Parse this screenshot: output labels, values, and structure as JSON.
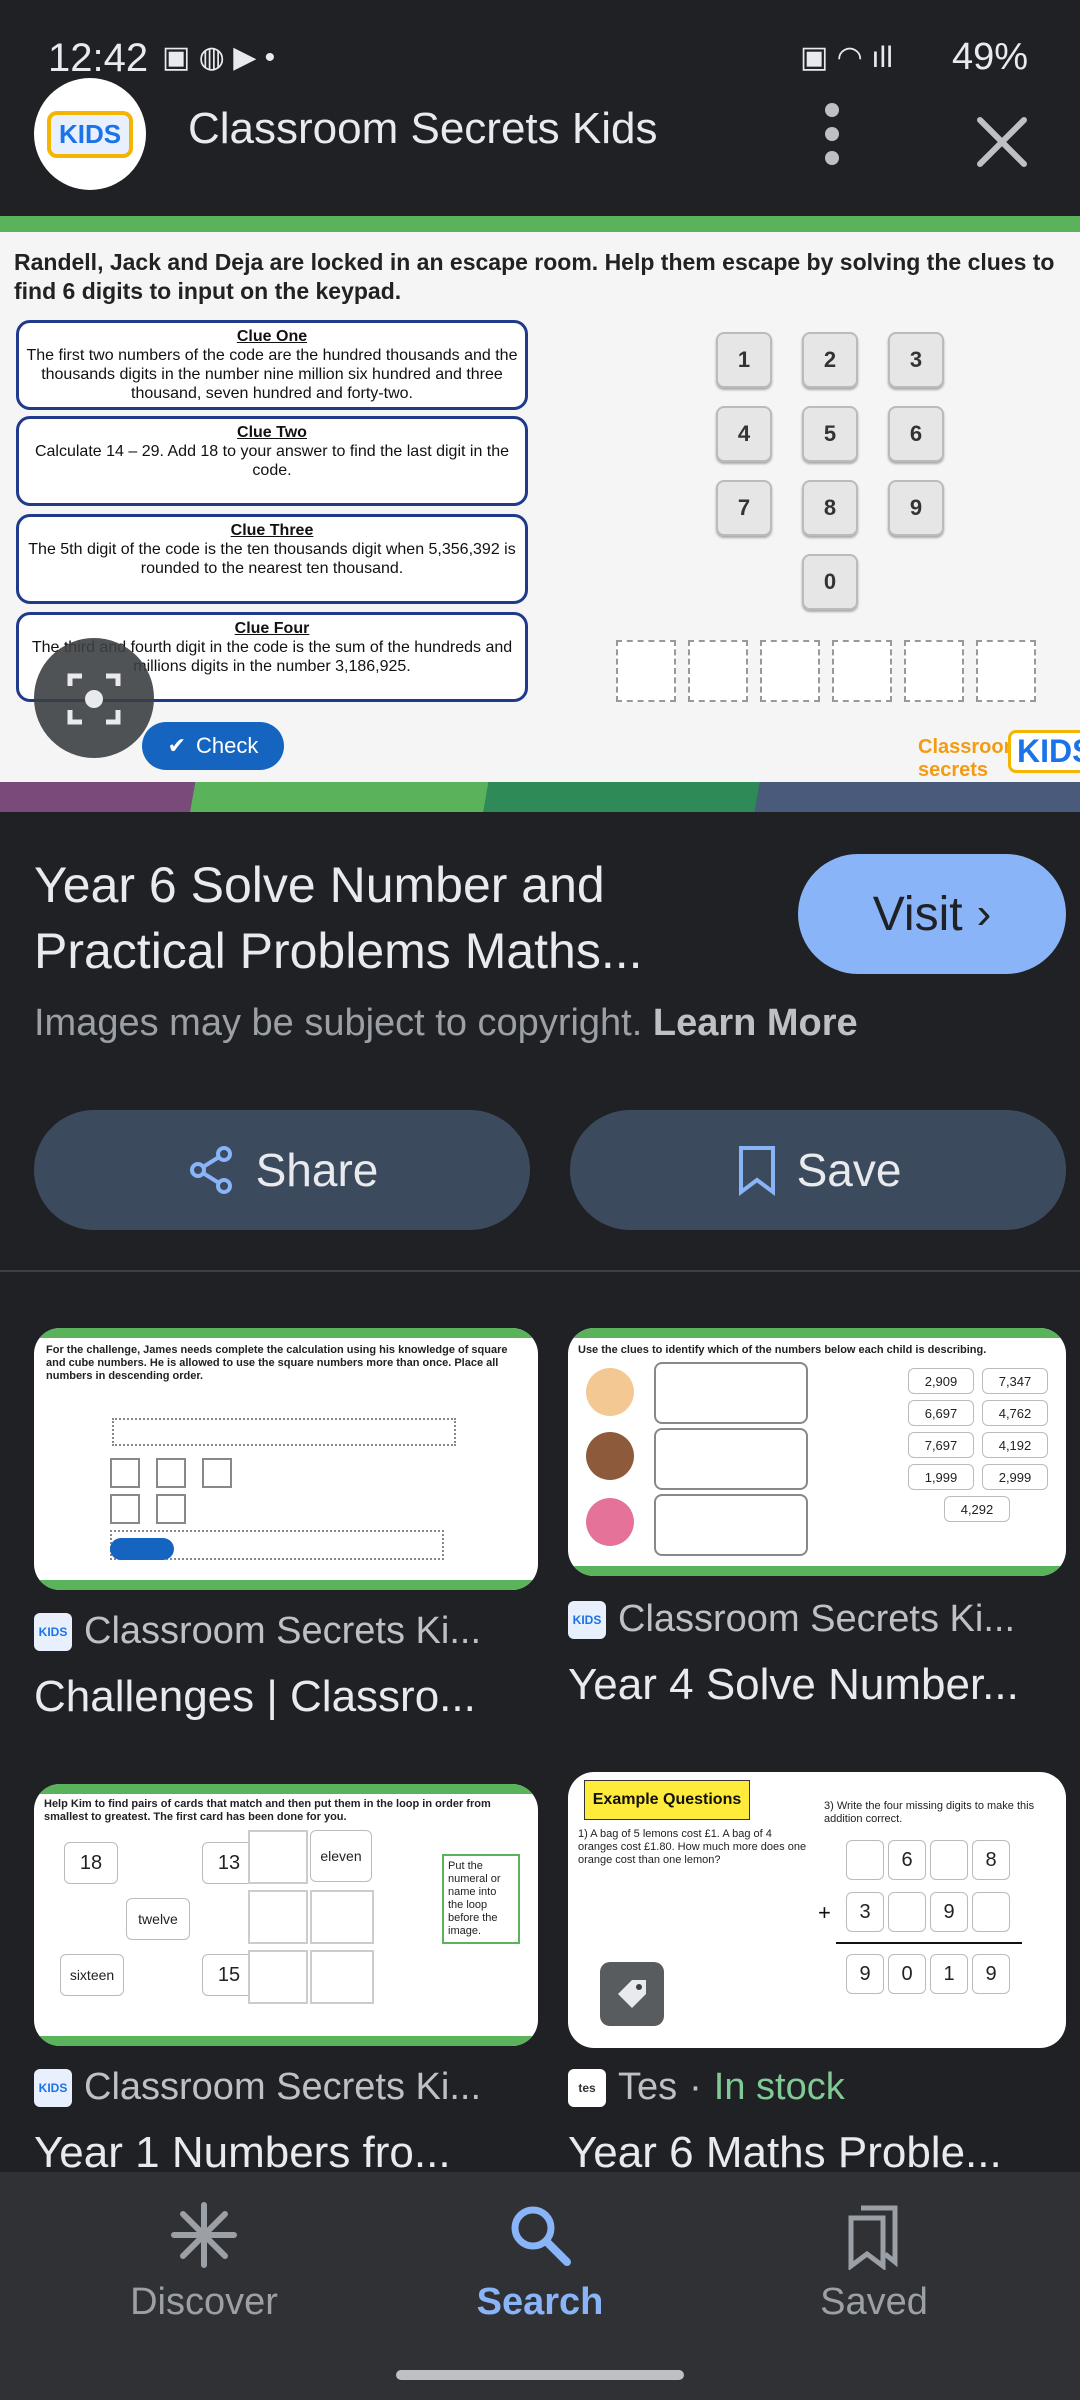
{
  "status_bar": {
    "time": "12:42",
    "battery": "49%"
  },
  "header": {
    "site_name": "Classroom Secrets Kids",
    "logo_text": "KIDS"
  },
  "preview": {
    "intro": "Randell, Jack and Deja are locked in an escape room. Help them escape by solving the clues to find 6 digits to input on the keypad.",
    "clues": [
      {
        "title": "Clue One",
        "text": "The first two numbers of the code are the hundred thousands and the thousands digits in the number nine million six hundred and three thousand, seven hundred and forty-two."
      },
      {
        "title": "Clue Two",
        "text": "Calculate 14 – 29. Add 18 to your answer to find the last digit in the code."
      },
      {
        "title": "Clue Three",
        "text": "The 5th digit of the code is the ten thousands digit when 5,356,392 is rounded to the nearest ten thousand."
      },
      {
        "title": "Clue Four",
        "text": "The third and fourth digit in the code is the sum of the hundreds and millions digits in the number 3,186,925."
      }
    ],
    "keys": [
      "1",
      "2",
      "3",
      "4",
      "5",
      "6",
      "7",
      "8",
      "9",
      "0"
    ],
    "check_label": "Check",
    "brand": "Classroom secrets",
    "brand_kids": "KIDS"
  },
  "detail": {
    "title": "Year 6 Solve Number and Practical Problems Maths...",
    "visit_label": "Visit",
    "copyright": "Images may be subject to copyright.",
    "learn_more": "Learn More",
    "share_label": "Share",
    "save_label": "Save"
  },
  "results": [
    {
      "source": "Classroom Secrets Ki...",
      "title": "Challenges | Classro...",
      "thumb_text": "For the challenge, James needs complete the calculation using his knowledge of square and cube numbers. He is allowed to use the square numbers more than once. Place all numbers in descending order."
    },
    {
      "source": "Classroom Secrets Ki...",
      "title": "Year 4 Solve Number...",
      "thumb_text": "Use the clues to identify which of the numbers below each child is describing.",
      "numbers": [
        "2,909",
        "7,347",
        "6,697",
        "4,762",
        "7,697",
        "4,192",
        "1,999",
        "2,999",
        "4,292"
      ]
    },
    {
      "source": "Classroom Secrets Ki...",
      "title": "Year 1 Numbers fro...",
      "thumb_text": "Help Kim to find pairs of cards that match and then put them in the loop in order from smallest to greatest. The first card has been done for you.",
      "cards": [
        "18",
        "13",
        "twelve",
        "sixteen",
        "15",
        "eleven"
      ],
      "side_note": "Put the numeral or name into the loop before the image."
    },
    {
      "source": "Tes",
      "stock": "In stock",
      "title": "Year 6 Maths Proble...",
      "thumb_heading": "Example Questions",
      "thumb_text": "1) A bag of 5 lemons cost £1. A bag of 4 oranges cost £1.80. How much more does one orange cost than one lemon?",
      "thumb_text2": "3) Write the four missing digits to make this addition correct.",
      "sum_digits": [
        "6",
        "8",
        "3",
        "9",
        "9",
        "0",
        "1",
        "9"
      ]
    }
  ],
  "nav": {
    "discover": "Discover",
    "search": "Search",
    "saved": "Saved"
  }
}
